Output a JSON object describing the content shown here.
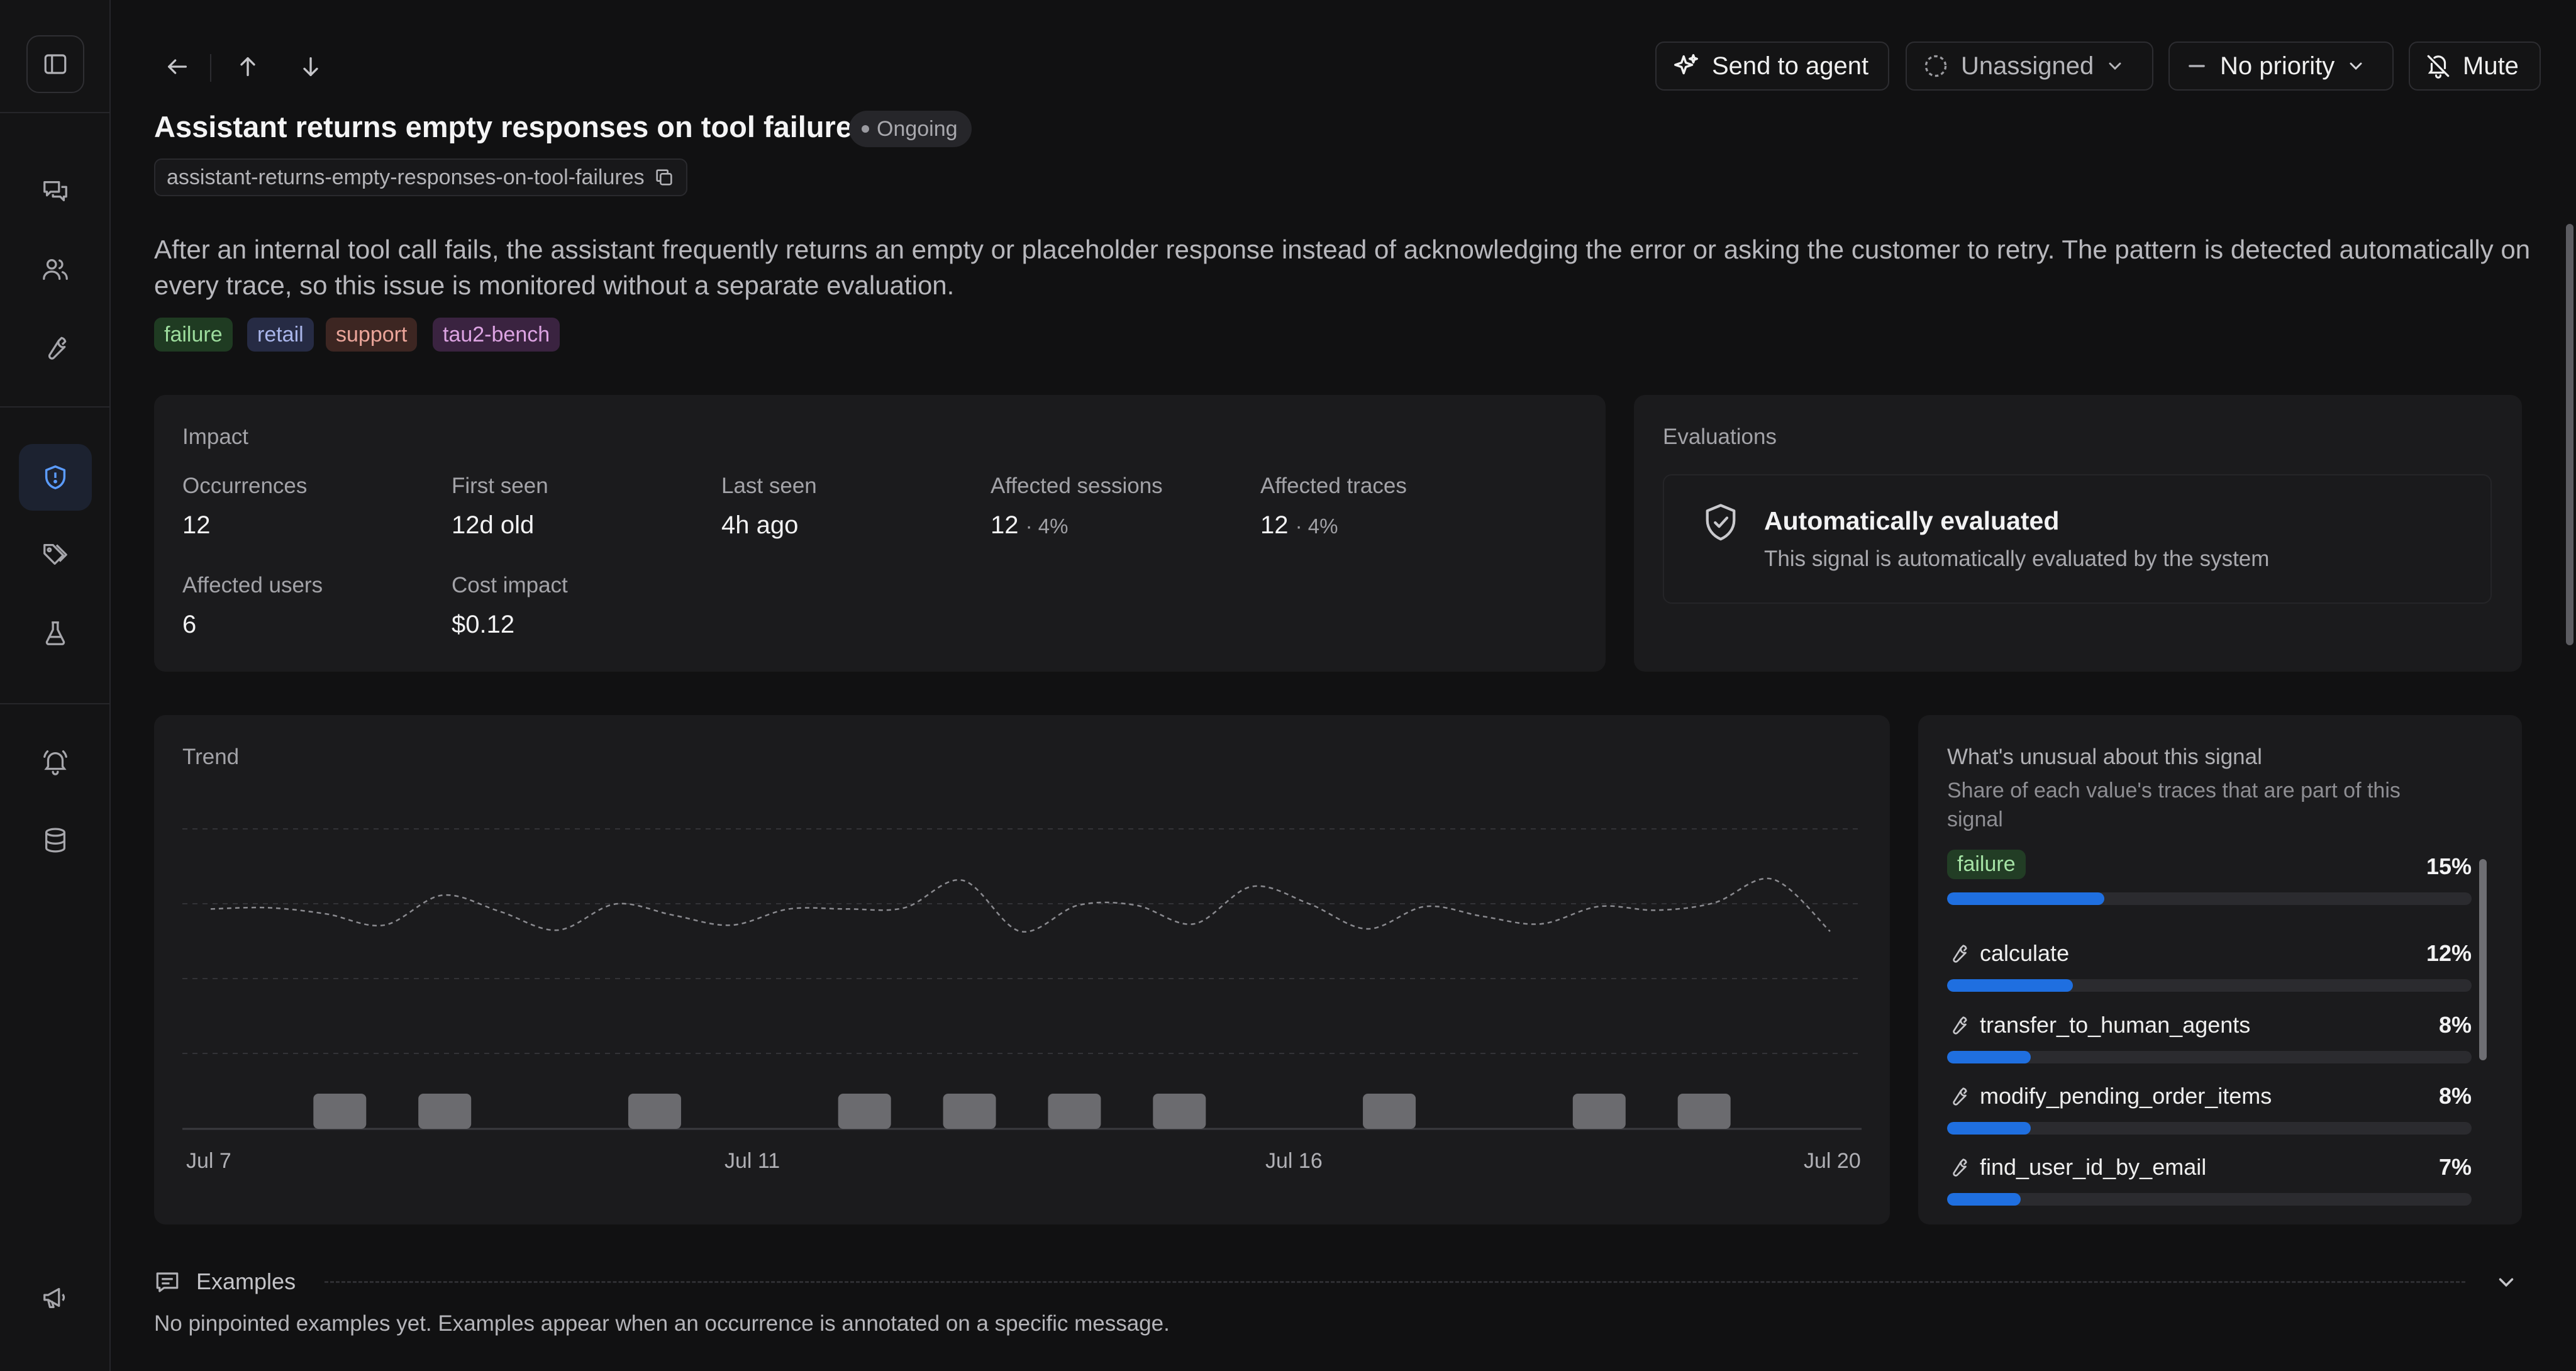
{
  "header": {
    "send_to_agent": "Send to agent",
    "assignee": "Unassigned",
    "priority": "No priority",
    "mute": "Mute"
  },
  "issue": {
    "title": "Assistant returns empty responses on tool failures",
    "status": "Ongoing",
    "slug": "assistant-returns-empty-responses-on-tool-failures",
    "description": "After an internal tool call fails, the assistant frequently returns an empty or placeholder response instead of acknowledging the error or asking the customer to retry. The pattern is detected automatically on every trace, so this issue is monitored without a separate evaluation.",
    "tags": [
      {
        "label": "failure",
        "bg": "#1f3b22",
        "fg": "#9ddc9d"
      },
      {
        "label": "retail",
        "bg": "#262b44",
        "fg": "#a9b5ea"
      },
      {
        "label": "support",
        "bg": "#3d2622",
        "fg": "#eba59a"
      },
      {
        "label": "tau2-bench",
        "bg": "#3a2340",
        "fg": "#dca3e2"
      }
    ]
  },
  "impact": {
    "heading": "Impact",
    "occurrences_label": "Occurrences",
    "occurrences": "12",
    "first_seen_label": "First seen",
    "first_seen": "12d old",
    "last_seen_label": "Last seen",
    "last_seen": "4h ago",
    "sessions_label": "Affected sessions",
    "sessions": "12",
    "sessions_pct": "· 4%",
    "traces_label": "Affected traces",
    "traces": "12",
    "traces_pct": "· 4%",
    "users_label": "Affected users",
    "users": "6",
    "cost_label": "Cost impact",
    "cost": "$0.12"
  },
  "evaluations": {
    "heading": "Evaluations",
    "title": "Automatically evaluated",
    "subtitle": "This signal is automatically evaluated by the system"
  },
  "trend": {
    "heading": "Trend"
  },
  "chart_data": {
    "type": "bar",
    "title": "Trend",
    "x_ticks": [
      "Jul 7",
      "Jul 11",
      "Jul 16",
      "Jul 20"
    ],
    "days": [
      "Jul 7",
      "Jul 8",
      "Jul 9",
      "Jul 10",
      "Jul 11",
      "Jul 12",
      "Jul 13",
      "Jul 14",
      "Jul 15",
      "Jul 16",
      "Jul 17",
      "Jul 18",
      "Jul 19",
      "Jul 20"
    ],
    "series": [
      {
        "type": "bar",
        "values": [
          0,
          1,
          1,
          0,
          1,
          0,
          1,
          1,
          1,
          1,
          0,
          1,
          0,
          1,
          1,
          0
        ]
      },
      {
        "type": "line",
        "style": "dashed",
        "values": [
          0.66,
          0.67,
          0.62,
          0.53,
          0.77,
          0.64,
          0.49,
          0.7,
          0.61,
          0.53,
          0.66,
          0.66,
          0.67,
          0.89,
          0.48,
          0.69,
          0.69,
          0.54,
          0.84,
          0.7,
          0.5,
          0.68,
          0.6,
          0.54,
          0.68,
          0.65,
          0.71,
          0.9,
          0.48
        ]
      }
    ],
    "ylim": [
      0,
      1
    ],
    "grid": true
  },
  "unusual": {
    "heading": "What's unusual about this signal",
    "subheading": "Share of each value's traces that are part of this signal",
    "rows": [
      {
        "name": "failure",
        "pct": "15%",
        "value": 0.15,
        "kind": "tag"
      },
      {
        "name": "calculate",
        "pct": "12%",
        "value": 0.12,
        "kind": "tool"
      },
      {
        "name": "transfer_to_human_agents",
        "pct": "8%",
        "value": 0.08,
        "kind": "tool"
      },
      {
        "name": "modify_pending_order_items",
        "pct": "8%",
        "value": 0.08,
        "kind": "tool"
      },
      {
        "name": "find_user_id_by_email",
        "pct": "7%",
        "value": 0.07,
        "kind": "tool"
      }
    ]
  },
  "examples": {
    "heading": "Examples",
    "empty": "No pinpointed examples yet. Examples appear when an occurrence is annotated on a specific message."
  },
  "colors": {
    "accent": "#1f6fe0",
    "bar": "#6b6b6f"
  }
}
